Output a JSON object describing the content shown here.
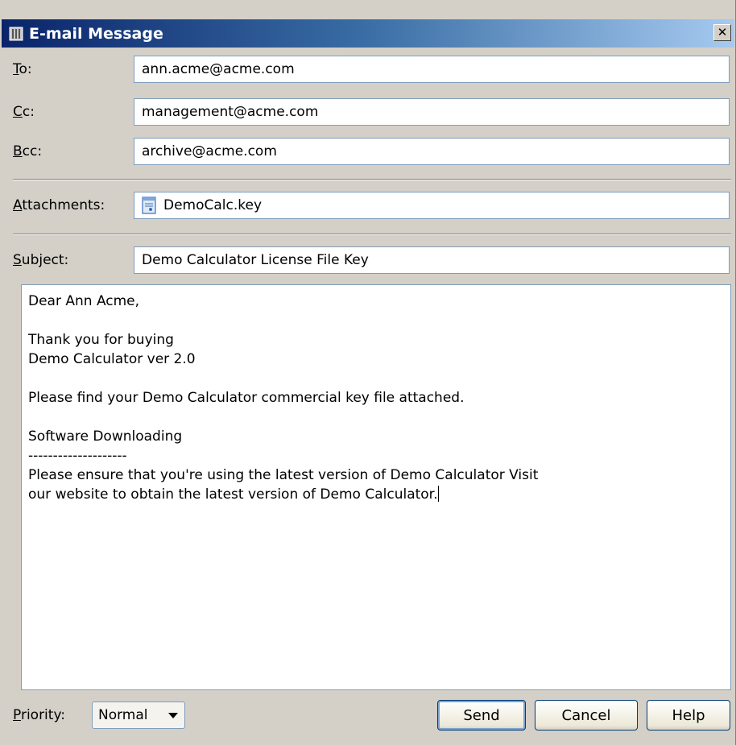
{
  "window": {
    "title": "E-mail Message",
    "close_label": "✕"
  },
  "fields": {
    "to": {
      "label_mnemonic": "T",
      "label_rest": "o:",
      "value": "ann.acme@acme.com"
    },
    "cc": {
      "label_mnemonic": "C",
      "label_rest": "c:",
      "value": "management@acme.com"
    },
    "bcc": {
      "label_mnemonic": "B",
      "label_rest": "cc:",
      "value": "archive@acme.com"
    },
    "attachments": {
      "label_mnemonic": "A",
      "label_rest": "ttachments:",
      "file_name": "DemoCalc.key"
    },
    "subject": {
      "label_mnemonic": "S",
      "label_rest": "ubject:",
      "value": "Demo Calculator License File Key"
    }
  },
  "body": {
    "lines": [
      "Dear Ann Acme,",
      "",
      "Thank you for buying",
      "Demo Calculator ver 2.0",
      "",
      "Please find your Demo Calculator commercial key file attached.",
      "",
      "Software Downloading",
      "--------------------",
      "Please ensure that you're using the latest version of Demo Calculator Visit",
      "our website to obtain the latest version of Demo Calculator."
    ]
  },
  "footer": {
    "priority_mnemonic": "P",
    "priority_rest": "riority:",
    "priority_value": "Normal",
    "send_label": "Send",
    "cancel_label": "Cancel",
    "help_label": "Help"
  },
  "icons": {
    "app": "mail-app-icon",
    "attachment": "document-file-icon",
    "close": "close-icon",
    "dropdown": "chevron-down-icon"
  }
}
